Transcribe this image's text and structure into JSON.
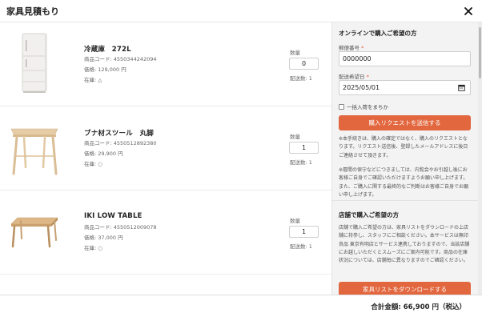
{
  "header": {
    "title": "家具見積もり"
  },
  "items": [
    {
      "name": "冷蔵庫　272L",
      "code": "商品コード: 4550344242094",
      "price": "価格: 129,000 円",
      "stock": "在庫: △",
      "qty_label": "数量",
      "qty": "0",
      "ship_count": "配送数: 1",
      "image": "refrigerator-image"
    },
    {
      "name": "ブナ材スツール　丸脚",
      "code": "商品コード: 4550512892380",
      "price": "価格: 29,900 円",
      "stock": "在庫: ○",
      "qty_label": "数量",
      "qty": "1",
      "ship_count": "配送数: 1",
      "image": "stool-image"
    },
    {
      "name": "IKI LOW TABLE",
      "code": "商品コード: 4550512009078",
      "price": "価格: 37,000 円",
      "stock": "在庫: ○",
      "qty_label": "数量",
      "qty": "1",
      "ship_count": "配送数: 1",
      "image": "low-table-image"
    }
  ],
  "online": {
    "heading": "オンラインで購入ご希望の方",
    "postal_label": "郵便番号",
    "postal_value": "0000000",
    "date_label": "配送希望日",
    "date_value": "2025/05/01",
    "required_mark": "*",
    "checkbox_label": "一括入荷をまちか",
    "submit_label": "購入リクエストを送信する",
    "note1": "※本手続きは、購入の確定ではなく、購入のリクエストとなります。リクエスト送信後、登録したメールアドレスに後日ご連絡させて頂きます。",
    "note2": "※層間の保守などにつきましては、内覧会やお引越し後にお客様ご自身でご確認いただけますようお願い申し上げます。また、ご購入に関する最終的なご判断はお客様ご自身でお願い申し上げます。"
  },
  "store": {
    "heading": "店舗で購入ご希望の方",
    "note": "店舗で購入ご希望の方は、家具リストをダウンロードの上店舗に持参し、スタッフにご相談ください。本サービスは無印良品 東京有明店とサービス連携しておりますので、当該店舗にお越しいただくとスムーズにご案内可能です。商品の在庫状況については、店舗毎に異なりますのでご確認ください。",
    "download_label": "家具リストをダウンロードする"
  },
  "footer": {
    "total": "合計金額: 66,900 円（税込）"
  },
  "colors": {
    "accent": "#e2673f",
    "required": "#e2563b"
  }
}
